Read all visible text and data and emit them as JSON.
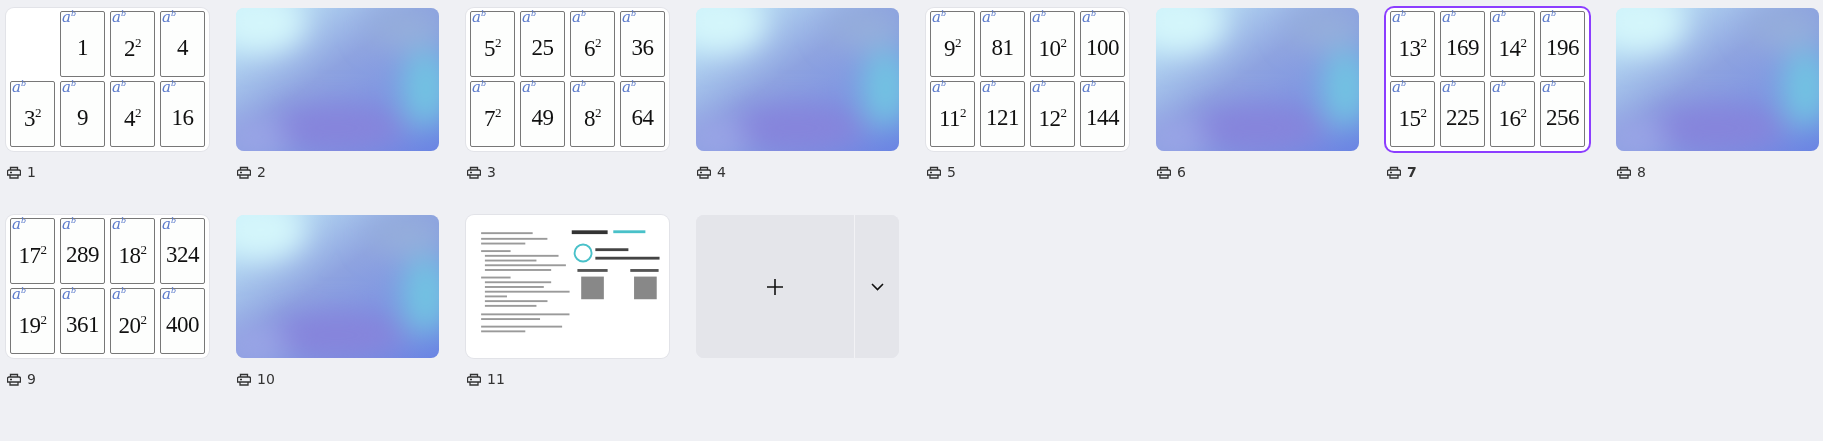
{
  "pages": [
    {
      "kind": "cards",
      "number": "1",
      "selected": false,
      "cards": [
        {
          "kind": "empty"
        },
        {
          "kind": "card",
          "mark": "a$^{b}$",
          "value": "1"
        },
        {
          "kind": "card",
          "mark": "a$^{b}$",
          "value": "2$^{2}$"
        },
        {
          "kind": "card",
          "mark": "a$^{b}$",
          "value": "4"
        },
        {
          "kind": "card",
          "mark": "a$^{b}$",
          "value": "3$^{2}$"
        },
        {
          "kind": "card",
          "mark": "a$^{b}$",
          "value": "9"
        },
        {
          "kind": "card",
          "mark": "a$^{b}$",
          "value": "4$^{2}$"
        },
        {
          "kind": "card",
          "mark": "a$^{b}$",
          "value": "16"
        }
      ]
    },
    {
      "kind": "gradient",
      "number": "2",
      "selected": false
    },
    {
      "kind": "cards",
      "number": "3",
      "selected": false,
      "cards": [
        {
          "kind": "card",
          "mark": "a$^{b}$",
          "value": "5$^{2}$"
        },
        {
          "kind": "card",
          "mark": "a$^{b}$",
          "value": "25"
        },
        {
          "kind": "card",
          "mark": "a$^{b}$",
          "value": "6$^{2}$"
        },
        {
          "kind": "card",
          "mark": "a$^{b}$",
          "value": "36"
        },
        {
          "kind": "card",
          "mark": "a$^{b}$",
          "value": "7$^{2}$"
        },
        {
          "kind": "card",
          "mark": "a$^{b}$",
          "value": "49"
        },
        {
          "kind": "card",
          "mark": "a$^{b}$",
          "value": "8$^{2}$"
        },
        {
          "kind": "card",
          "mark": "a$^{b}$",
          "value": "64"
        }
      ]
    },
    {
      "kind": "gradient",
      "number": "4",
      "selected": false
    },
    {
      "kind": "cards",
      "number": "5",
      "selected": false,
      "cards": [
        {
          "kind": "card",
          "mark": "a$^{b}$",
          "value": "9$^{2}$"
        },
        {
          "kind": "card",
          "mark": "a$^{b}$",
          "value": "81"
        },
        {
          "kind": "card",
          "mark": "a$^{b}$",
          "value": "10$^{2}$"
        },
        {
          "kind": "card",
          "mark": "a$^{b}$",
          "value": "100"
        },
        {
          "kind": "card",
          "mark": "a$^{b}$",
          "value": "11$^{2}$"
        },
        {
          "kind": "card",
          "mark": "a$^{b}$",
          "value": "121"
        },
        {
          "kind": "card",
          "mark": "a$^{b}$",
          "value": "12$^{2}$"
        },
        {
          "kind": "card",
          "mark": "a$^{b}$",
          "value": "144"
        }
      ]
    },
    {
      "kind": "gradient",
      "number": "6",
      "selected": false
    },
    {
      "kind": "cards",
      "number": "7",
      "selected": true,
      "cards": [
        {
          "kind": "card",
          "mark": "a$^{b}$",
          "value": "13$^{2}$"
        },
        {
          "kind": "card",
          "mark": "a$^{b}$",
          "value": "169"
        },
        {
          "kind": "card",
          "mark": "a$^{b}$",
          "value": "14$^{2}$"
        },
        {
          "kind": "card",
          "mark": "a$^{b}$",
          "value": "196"
        },
        {
          "kind": "card",
          "mark": "a$^{b}$",
          "value": "15$^{2}$"
        },
        {
          "kind": "card",
          "mark": "a$^{b}$",
          "value": "225"
        },
        {
          "kind": "card",
          "mark": "a$^{b}$",
          "value": "16$^{2}$"
        },
        {
          "kind": "card",
          "mark": "a$^{b}$",
          "value": "256"
        }
      ]
    },
    {
      "kind": "gradient",
      "number": "8",
      "selected": false
    },
    {
      "kind": "cards",
      "number": "9",
      "selected": false,
      "cards": [
        {
          "kind": "card",
          "mark": "a$^{b}$",
          "value": "17$^{2}$"
        },
        {
          "kind": "card",
          "mark": "a$^{b}$",
          "value": "289"
        },
        {
          "kind": "card",
          "mark": "a$^{b}$",
          "value": "18$^{2}$"
        },
        {
          "kind": "card",
          "mark": "a$^{b}$",
          "value": "324"
        },
        {
          "kind": "card",
          "mark": "a$^{b}$",
          "value": "19$^{2}$"
        },
        {
          "kind": "card",
          "mark": "a$^{b}$",
          "value": "361"
        },
        {
          "kind": "card",
          "mark": "a$^{b}$",
          "value": "20$^{2}$"
        },
        {
          "kind": "card",
          "mark": "a$^{b}$",
          "value": "400"
        }
      ]
    },
    {
      "kind": "gradient",
      "number": "10",
      "selected": false
    },
    {
      "kind": "document",
      "number": "11",
      "selected": false
    },
    {
      "kind": "add"
    }
  ]
}
